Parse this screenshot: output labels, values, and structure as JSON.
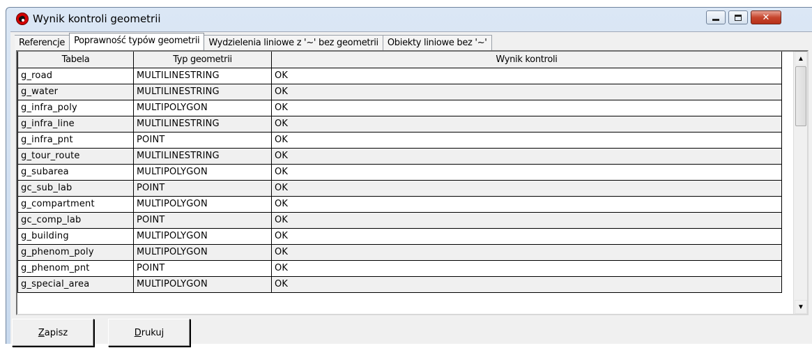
{
  "window": {
    "title": "Wynik kontroli geometrii",
    "min_glyph": "",
    "close_glyph": "✕"
  },
  "tabs": [
    {
      "label": "Referencje"
    },
    {
      "label": "Poprawność typów geometrii"
    },
    {
      "label": "Wydzielenia liniowe z '~' bez geometrii"
    },
    {
      "label": "Obiekty liniowe bez '~'"
    }
  ],
  "table": {
    "headers": [
      "Tabela",
      "Typ geometrii",
      "Wynik kontroli"
    ],
    "rows": [
      [
        "g_road",
        "MULTILINESTRING",
        "OK"
      ],
      [
        "g_water",
        "MULTILINESTRING",
        "OK"
      ],
      [
        "g_infra_poly",
        "MULTIPOLYGON",
        "OK"
      ],
      [
        "g_infra_line",
        "MULTILINESTRING",
        "OK"
      ],
      [
        "g_infra_pnt",
        "POINT",
        "OK"
      ],
      [
        "g_tour_route",
        "MULTILINESTRING",
        "OK"
      ],
      [
        "g_subarea",
        "MULTIPOLYGON",
        "OK"
      ],
      [
        "gc_sub_lab",
        "POINT",
        "OK"
      ],
      [
        "g_compartment",
        "MULTIPOLYGON",
        "OK"
      ],
      [
        "gc_comp_lab",
        "POINT",
        "OK"
      ],
      [
        "g_building",
        "MULTIPOLYGON",
        "OK"
      ],
      [
        "g_phenom_poly",
        "MULTIPOLYGON",
        "OK"
      ],
      [
        "g_phenom_pnt",
        "POINT",
        "OK"
      ],
      [
        "g_special_area",
        "MULTIPOLYGON",
        "OK"
      ]
    ]
  },
  "scrollbar": {
    "up_glyph": "▲",
    "down_glyph": "▼"
  },
  "buttons": {
    "save": {
      "mnemonic": "Z",
      "rest": "apisz"
    },
    "print": {
      "mnemonic": "D",
      "rest": "rukuj"
    }
  }
}
